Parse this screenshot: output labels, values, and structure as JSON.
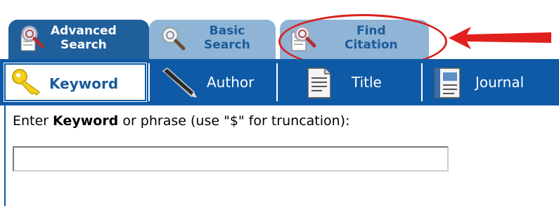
{
  "tabs": {
    "advanced": {
      "line1": "Advanced",
      "line2": "Search"
    },
    "basic": {
      "line1": "Basic",
      "line2": "Search"
    },
    "find": {
      "line1": "Find",
      "line2": "Citation"
    }
  },
  "fields": [
    {
      "label": "Keyword",
      "icon": "key-icon"
    },
    {
      "label": "Author",
      "icon": "pen-icon"
    },
    {
      "label": "Title",
      "icon": "document-icon"
    },
    {
      "label": "Journal",
      "icon": "journal-icon"
    }
  ],
  "instruction": {
    "pre": "Enter ",
    "bold": "Keyword",
    "post": " or phrase (use \"$\" for truncation):"
  },
  "search_input": {
    "value": ""
  },
  "colors": {
    "active_tab": "#1f5f9c",
    "inactive_tab": "#8fb4d6",
    "field_bar": "#0e5aa7",
    "highlight": "#d9231e"
  }
}
